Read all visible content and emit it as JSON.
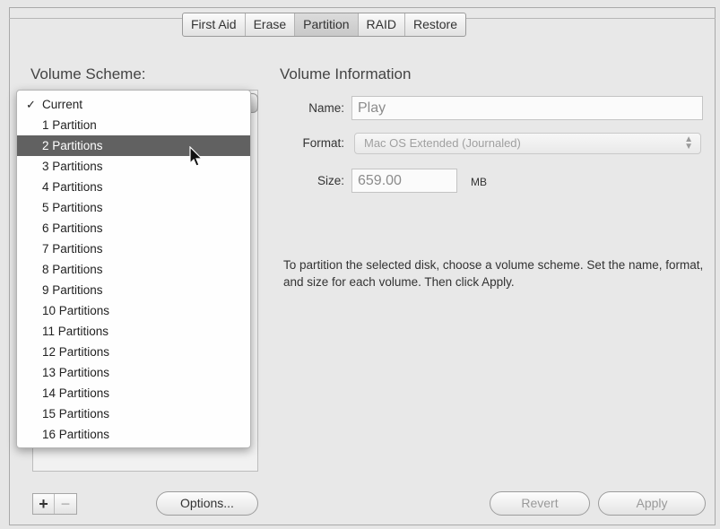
{
  "tabs": [
    {
      "label": "First Aid",
      "selected": false
    },
    {
      "label": "Erase",
      "selected": false
    },
    {
      "label": "Partition",
      "selected": true
    },
    {
      "label": "RAID",
      "selected": false
    },
    {
      "label": "Restore",
      "selected": false
    }
  ],
  "volume_scheme": {
    "label": "Volume Scheme:",
    "menu_items": [
      "Current",
      "1 Partition",
      "2 Partitions",
      "3 Partitions",
      "4 Partitions",
      "5 Partitions",
      "6 Partitions",
      "7 Partitions",
      "8 Partitions",
      "9 Partitions",
      "10 Partitions",
      "11 Partitions",
      "12 Partitions",
      "13 Partitions",
      "14 Partitions",
      "15 Partitions",
      "16 Partitions"
    ],
    "checked_item": "Current",
    "highlighted_item": "2 Partitions",
    "checkmark": "✓"
  },
  "volume_info": {
    "heading": "Volume Information",
    "name_label": "Name:",
    "name_value": "Play",
    "format_label": "Format:",
    "format_value": "Mac OS Extended (Journaled)",
    "size_label": "Size:",
    "size_value": "659.00",
    "size_unit": "MB",
    "instructions": "To partition the selected disk, choose a volume scheme. Set the name, format, and size for each volume. Then click Apply."
  },
  "buttons": {
    "add": "+",
    "remove": "−",
    "options": "Options...",
    "revert": "Revert",
    "apply": "Apply"
  },
  "icons": {
    "cursor": "arrow-cursor-icon",
    "format_arrows": "updown-arrows-icon"
  }
}
